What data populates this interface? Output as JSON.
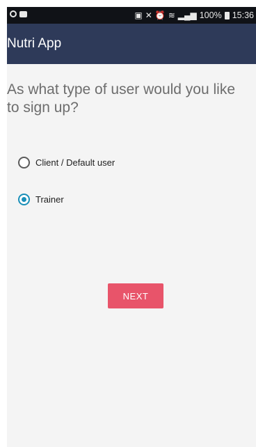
{
  "status_bar": {
    "battery_percent": "100%",
    "time": "15:36"
  },
  "app_bar": {
    "title": "Nutri App"
  },
  "signup": {
    "question": "As what type of user would you like to sign up?",
    "options": [
      {
        "label": "Client / Default user",
        "selected": false
      },
      {
        "label": "Trainer",
        "selected": true
      }
    ],
    "next_label": "NEXT"
  },
  "colors": {
    "app_bar": "#2e3a59",
    "accent": "#1a8fb8",
    "button": "#e8546a",
    "status_bar": "#101217"
  }
}
